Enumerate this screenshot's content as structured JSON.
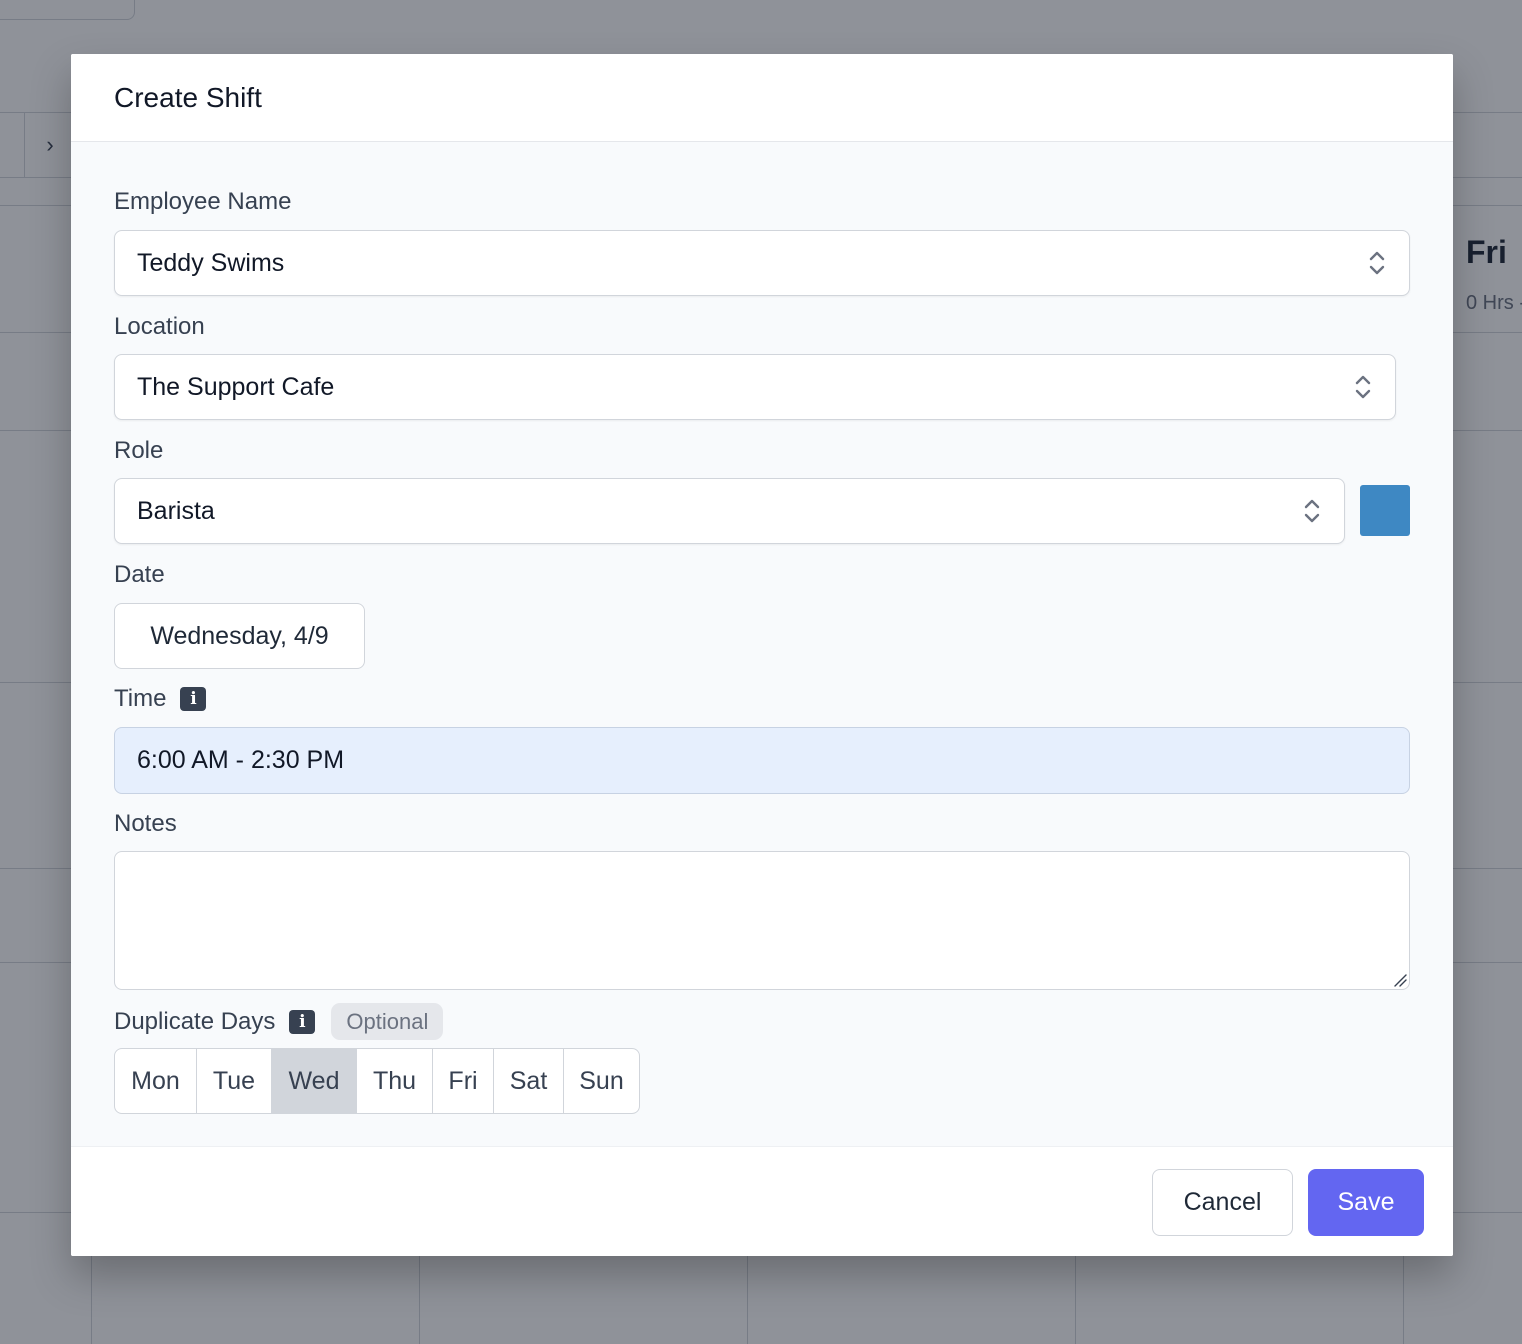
{
  "background": {
    "next_arrow": "›",
    "day_label": "Fri",
    "day_sub": "0 Hrs -"
  },
  "modal": {
    "title": "Create Shift",
    "employee": {
      "label": "Employee Name",
      "value": "Teddy Swims"
    },
    "location": {
      "label": "Location",
      "value": "The Support Cafe"
    },
    "role": {
      "label": "Role",
      "value": "Barista",
      "color": "#3e88c3"
    },
    "date": {
      "label": "Date",
      "value": "Wednesday, 4/9"
    },
    "time": {
      "label": "Time",
      "value": "6:00 AM - 2:30 PM"
    },
    "notes": {
      "label": "Notes",
      "value": ""
    },
    "duplicate": {
      "label": "Duplicate Days",
      "badge": "Optional",
      "days": [
        "Mon",
        "Tue",
        "Wed",
        "Thu",
        "Fri",
        "Sat",
        "Sun"
      ],
      "selected": "Wed"
    },
    "cancel_label": "Cancel",
    "save_label": "Save"
  },
  "colors": {
    "primary": "#6366f1",
    "time_field_bg": "#e6effd",
    "role_swatch": "#3e88c3"
  }
}
